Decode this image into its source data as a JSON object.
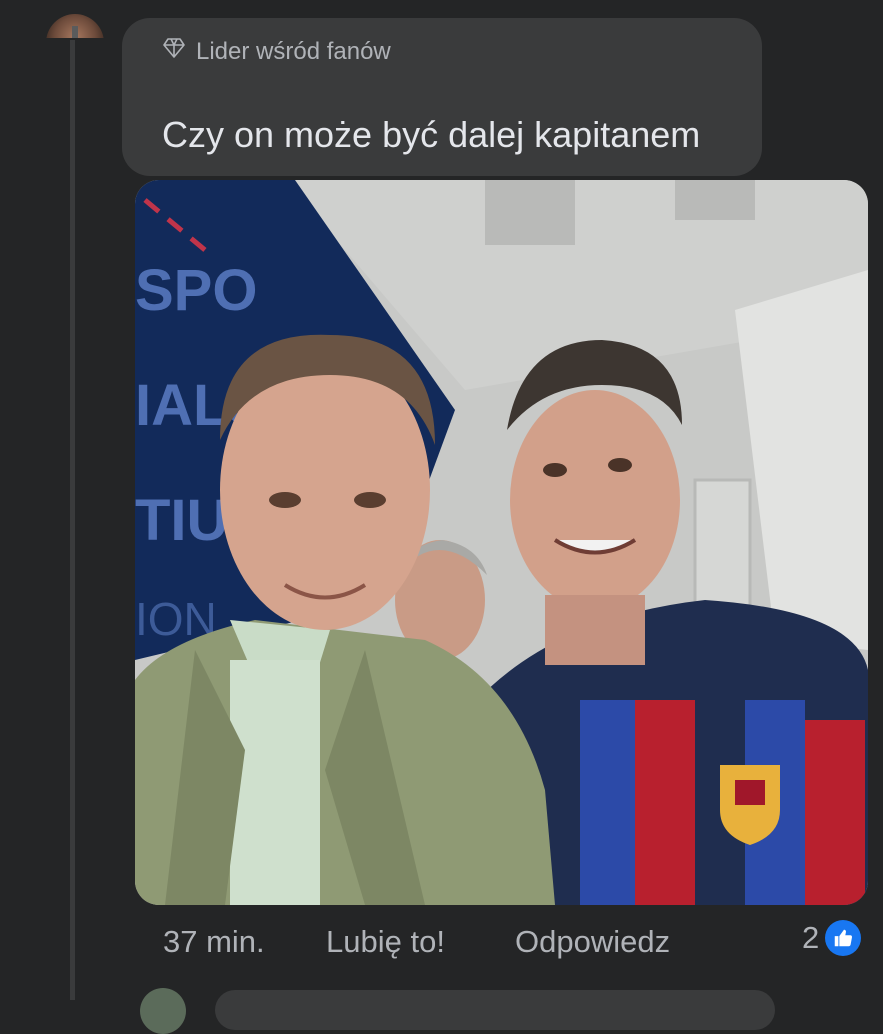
{
  "comment": {
    "badge_icon": "diamond-icon",
    "badge_label": "Lider wśród fanów",
    "text": "Czy on może być dalej kapitanem"
  },
  "photo": {
    "description_icon": "photo-image"
  },
  "actions": {
    "time": "37 min.",
    "like_label": "Lubię to!",
    "reply_label": "Odpowiedz",
    "reaction_count": "2",
    "reaction_icon": "thumbs-up-icon"
  },
  "colors": {
    "background": "#242526",
    "bubble": "#3a3b3c",
    "text_primary": "#e4e6eb",
    "text_secondary": "#b0b3b8",
    "like_blue": "#1877f2"
  }
}
